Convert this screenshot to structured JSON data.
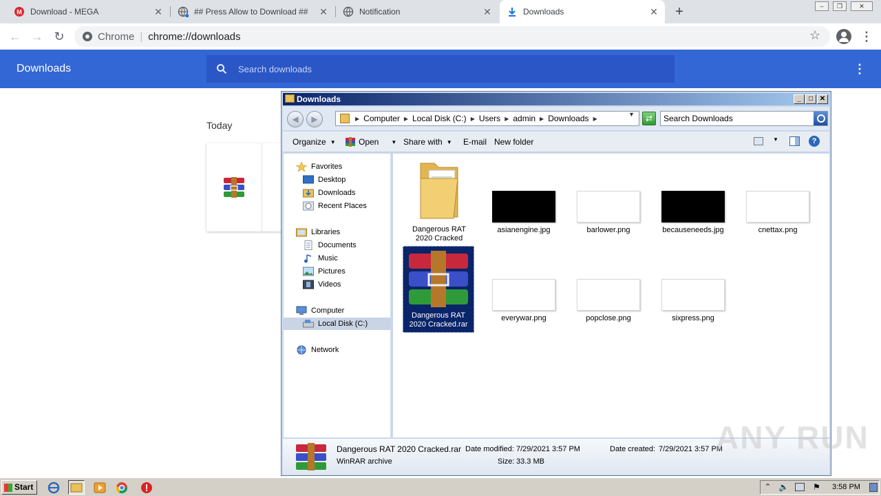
{
  "browser": {
    "tabs": [
      {
        "label": "Download - MEGA",
        "active": false,
        "icon": "mega-icon"
      },
      {
        "label": "## Press Allow to Download ##",
        "active": false,
        "icon": "globe-icon"
      },
      {
        "label": "Notification",
        "active": false,
        "icon": "globe-icon"
      },
      {
        "label": "Downloads",
        "active": true,
        "icon": "download-icon"
      }
    ],
    "omnibox": {
      "scheme": "Chrome",
      "url": "chrome://downloads"
    }
  },
  "downloads_page": {
    "title": "Downloads",
    "search_placeholder": "Search downloads",
    "section_label": "Today"
  },
  "explorer": {
    "title": "Downloads",
    "breadcrumb": [
      "Computer",
      "Local Disk (C:)",
      "Users",
      "admin",
      "Downloads"
    ],
    "search_placeholder": "Search Downloads",
    "commands": {
      "organize": "Organize",
      "open": "Open",
      "share_with": "Share with",
      "email": "E-mail",
      "new_folder": "New folder"
    },
    "nav": {
      "favorites": "Favorites",
      "desktop": "Desktop",
      "downloads": "Downloads",
      "recent_places": "Recent Places",
      "libraries": "Libraries",
      "documents": "Documents",
      "music": "Music",
      "pictures": "Pictures",
      "videos": "Videos",
      "computer": "Computer",
      "local_disk": "Local Disk (C:)",
      "network": "Network"
    },
    "files": [
      {
        "name": "Dangerous RAT 2020 Cracked",
        "kind": "folder"
      },
      {
        "name": "asianengine.jpg",
        "kind": "image",
        "thumb": "black"
      },
      {
        "name": "barlower.png",
        "kind": "image",
        "thumb": "white"
      },
      {
        "name": "becauseneeds.jpg",
        "kind": "image",
        "thumb": "black"
      },
      {
        "name": "cnettax.png",
        "kind": "image",
        "thumb": "white"
      },
      {
        "name": "Dangerous RAT 2020 Cracked.rar",
        "kind": "archive",
        "selected": true
      },
      {
        "name": "everywar.png",
        "kind": "image",
        "thumb": "white"
      },
      {
        "name": "popclose.png",
        "kind": "image",
        "thumb": "white"
      },
      {
        "name": "sixpress.png",
        "kind": "image",
        "thumb": "white"
      }
    ],
    "details": {
      "filename": "Dangerous RAT 2020 Cracked.rar",
      "type": "WinRAR archive",
      "date_modified_label": "Date modified:",
      "date_modified": "7/29/2021 3:57 PM",
      "size_label": "Size:",
      "size": "33.3 MB",
      "date_created_label": "Date created:",
      "date_created": "7/29/2021 3:57 PM"
    }
  },
  "taskbar": {
    "start_label": "Start",
    "clock": "3:58 PM"
  },
  "watermark": "ANY RUN",
  "colors": {
    "chrome_header": "#3367d6",
    "selection": "#0a246a",
    "winrar_red": "#c8283c",
    "winrar_blue": "#3a4fc8",
    "winrar_green": "#2f9a3a"
  }
}
